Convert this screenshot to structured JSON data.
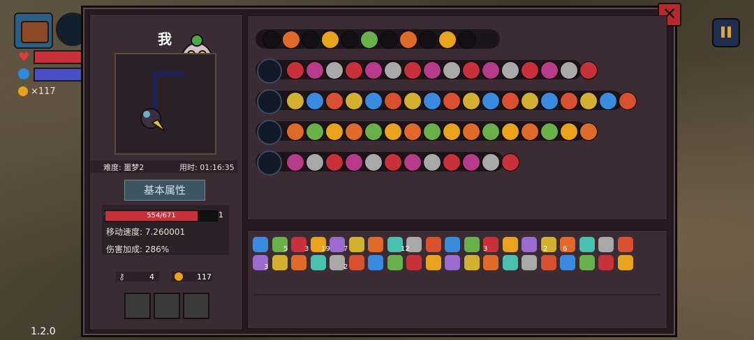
{
  "hud": {
    "gold": "×117",
    "version": "1.2.0"
  },
  "colors": {
    "hp": "#c8303a",
    "mana": "#4a4fc8",
    "gold": "#e8a21c",
    "panel": "#3b2c33",
    "frame": "#241a1f"
  },
  "player": {
    "name": "我",
    "difficulty": "难度: 噩梦2",
    "time": "用时: 01:16:35"
  },
  "attributes": {
    "title": "基本属性",
    "hp": "554/671",
    "hp_fraction": 0.825,
    "level": "1",
    "move_speed": "移动速度: 7.260001",
    "damage_bonus": "伤害加成: 286%",
    "keys": "4",
    "coins": "117"
  },
  "icons": {
    "close": "close-icon",
    "pause": "pause-icon",
    "heart": "heart-icon",
    "mana": "mana-orb-icon",
    "coin": "coin-icon",
    "key": "key-icon"
  },
  "inventory_counts": [
    "5",
    "3",
    "19",
    "7",
    "12",
    "3",
    "2",
    "6",
    "3",
    "2"
  ]
}
